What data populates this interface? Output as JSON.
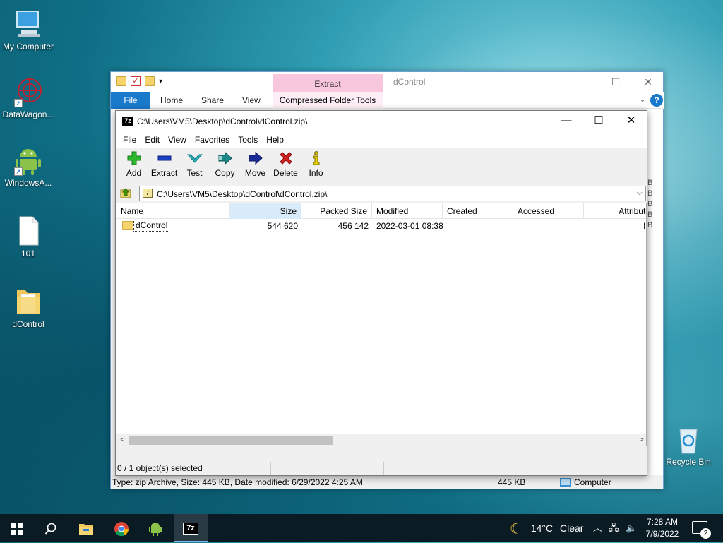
{
  "desktop": {
    "icons": [
      {
        "label": "My Computer"
      },
      {
        "label": "DataWagon..."
      },
      {
        "label": "WindowsA..."
      },
      {
        "label": "101"
      },
      {
        "label": "dControl"
      },
      {
        "label": "Recycle Bin"
      }
    ]
  },
  "explorer": {
    "title": "dControl",
    "context_tab": "Extract",
    "ribbon_tabs": [
      "File",
      "Home",
      "Share",
      "View"
    ],
    "context_group": "Compressed Folder Tools",
    "status_text": "Type: zip Archive, Size: 445 KB, Date modified: 6/29/2022 4:25 AM",
    "status_size": "445 KB",
    "status_location": "Computer",
    "right_strip": [
      "B",
      "B",
      "B",
      "B",
      "B"
    ]
  },
  "zip": {
    "title": "C:\\Users\\VM5\\Desktop\\dControl\\dControl.zip\\",
    "logo": "7z",
    "menu": [
      "File",
      "Edit",
      "View",
      "Favorites",
      "Tools",
      "Help"
    ],
    "toolbar": [
      {
        "label": "Add",
        "icon": "plus-icon",
        "color": "#2db82d"
      },
      {
        "label": "Extract",
        "icon": "minus-icon",
        "color": "#1a3fbf"
      },
      {
        "label": "Test",
        "icon": "check-icon",
        "color": "#2aaeb8"
      },
      {
        "label": "Copy",
        "icon": "copy-arrow-icon",
        "color": "#1c8a8a"
      },
      {
        "label": "Move",
        "icon": "move-arrow-icon",
        "color": "#1a2a99"
      },
      {
        "label": "Delete",
        "icon": "x-icon",
        "color": "#d42020"
      },
      {
        "label": "Info",
        "icon": "info-icon",
        "color": "#c9b000"
      }
    ],
    "address": "C:\\Users\\VM5\\Desktop\\dControl\\dControl.zip\\",
    "columns": [
      "Name",
      "Size",
      "Packed Size",
      "Modified",
      "Created",
      "Accessed",
      "Attribute"
    ],
    "rows": [
      {
        "name": "dControl",
        "size": "544 620",
        "packed": "456 142",
        "modified": "2022-03-01 08:38",
        "created": "",
        "accessed": "",
        "attr": "I"
      }
    ],
    "status": "0 / 1 object(s) selected"
  },
  "taskbar": {
    "weather_temp": "14°C",
    "weather_text": "Clear",
    "time": "7:28 AM",
    "date": "7/9/2022",
    "notification_count": "2"
  }
}
